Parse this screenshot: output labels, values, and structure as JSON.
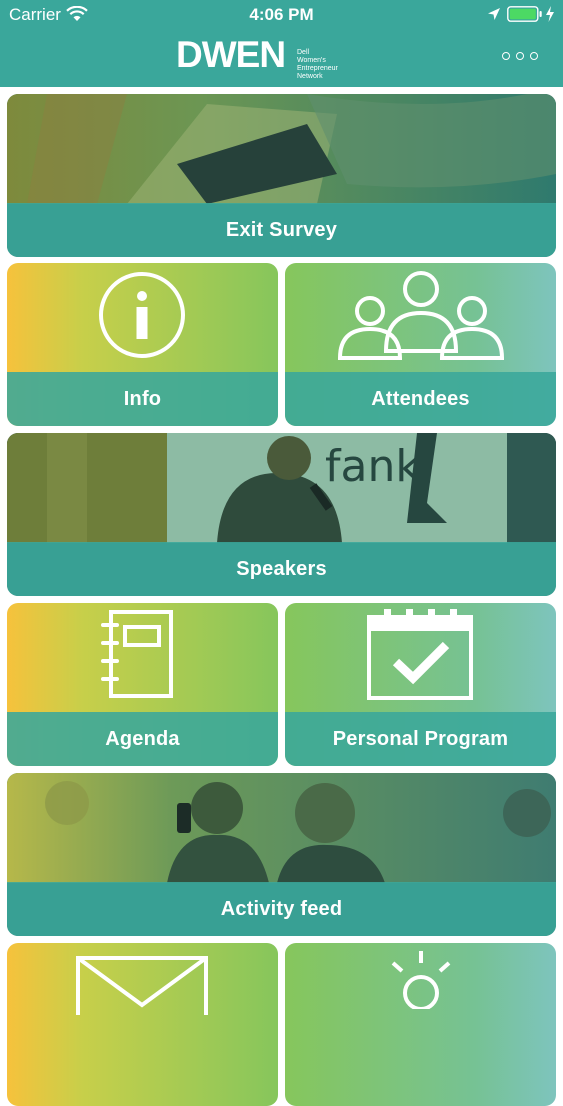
{
  "status_bar": {
    "carrier": "Carrier",
    "time": "4:06 PM"
  },
  "header": {
    "logo_mark": "DWEN",
    "logo_subtitle": [
      "Dell",
      "Women's",
      "Entrepreneur",
      "Network"
    ]
  },
  "tiles": [
    {
      "label": "Exit Survey",
      "icon": "phone-photo"
    },
    {
      "label": "Info",
      "icon": "info-icon"
    },
    {
      "label": "Attendees",
      "icon": "people-icon"
    },
    {
      "label": "Speakers",
      "icon": "speaker-photo"
    },
    {
      "label": "Agenda",
      "icon": "notebook-icon"
    },
    {
      "label": "Personal Program",
      "icon": "calendar-check-icon"
    },
    {
      "label": "Activity feed",
      "icon": "audience-photo"
    }
  ],
  "colors": {
    "header": "#3aa79b",
    "band": "#3aa79b",
    "gradient_yellow": "#f6c23c",
    "gradient_green": "#86c65c",
    "gradient_teal": "#7ec4bd"
  }
}
